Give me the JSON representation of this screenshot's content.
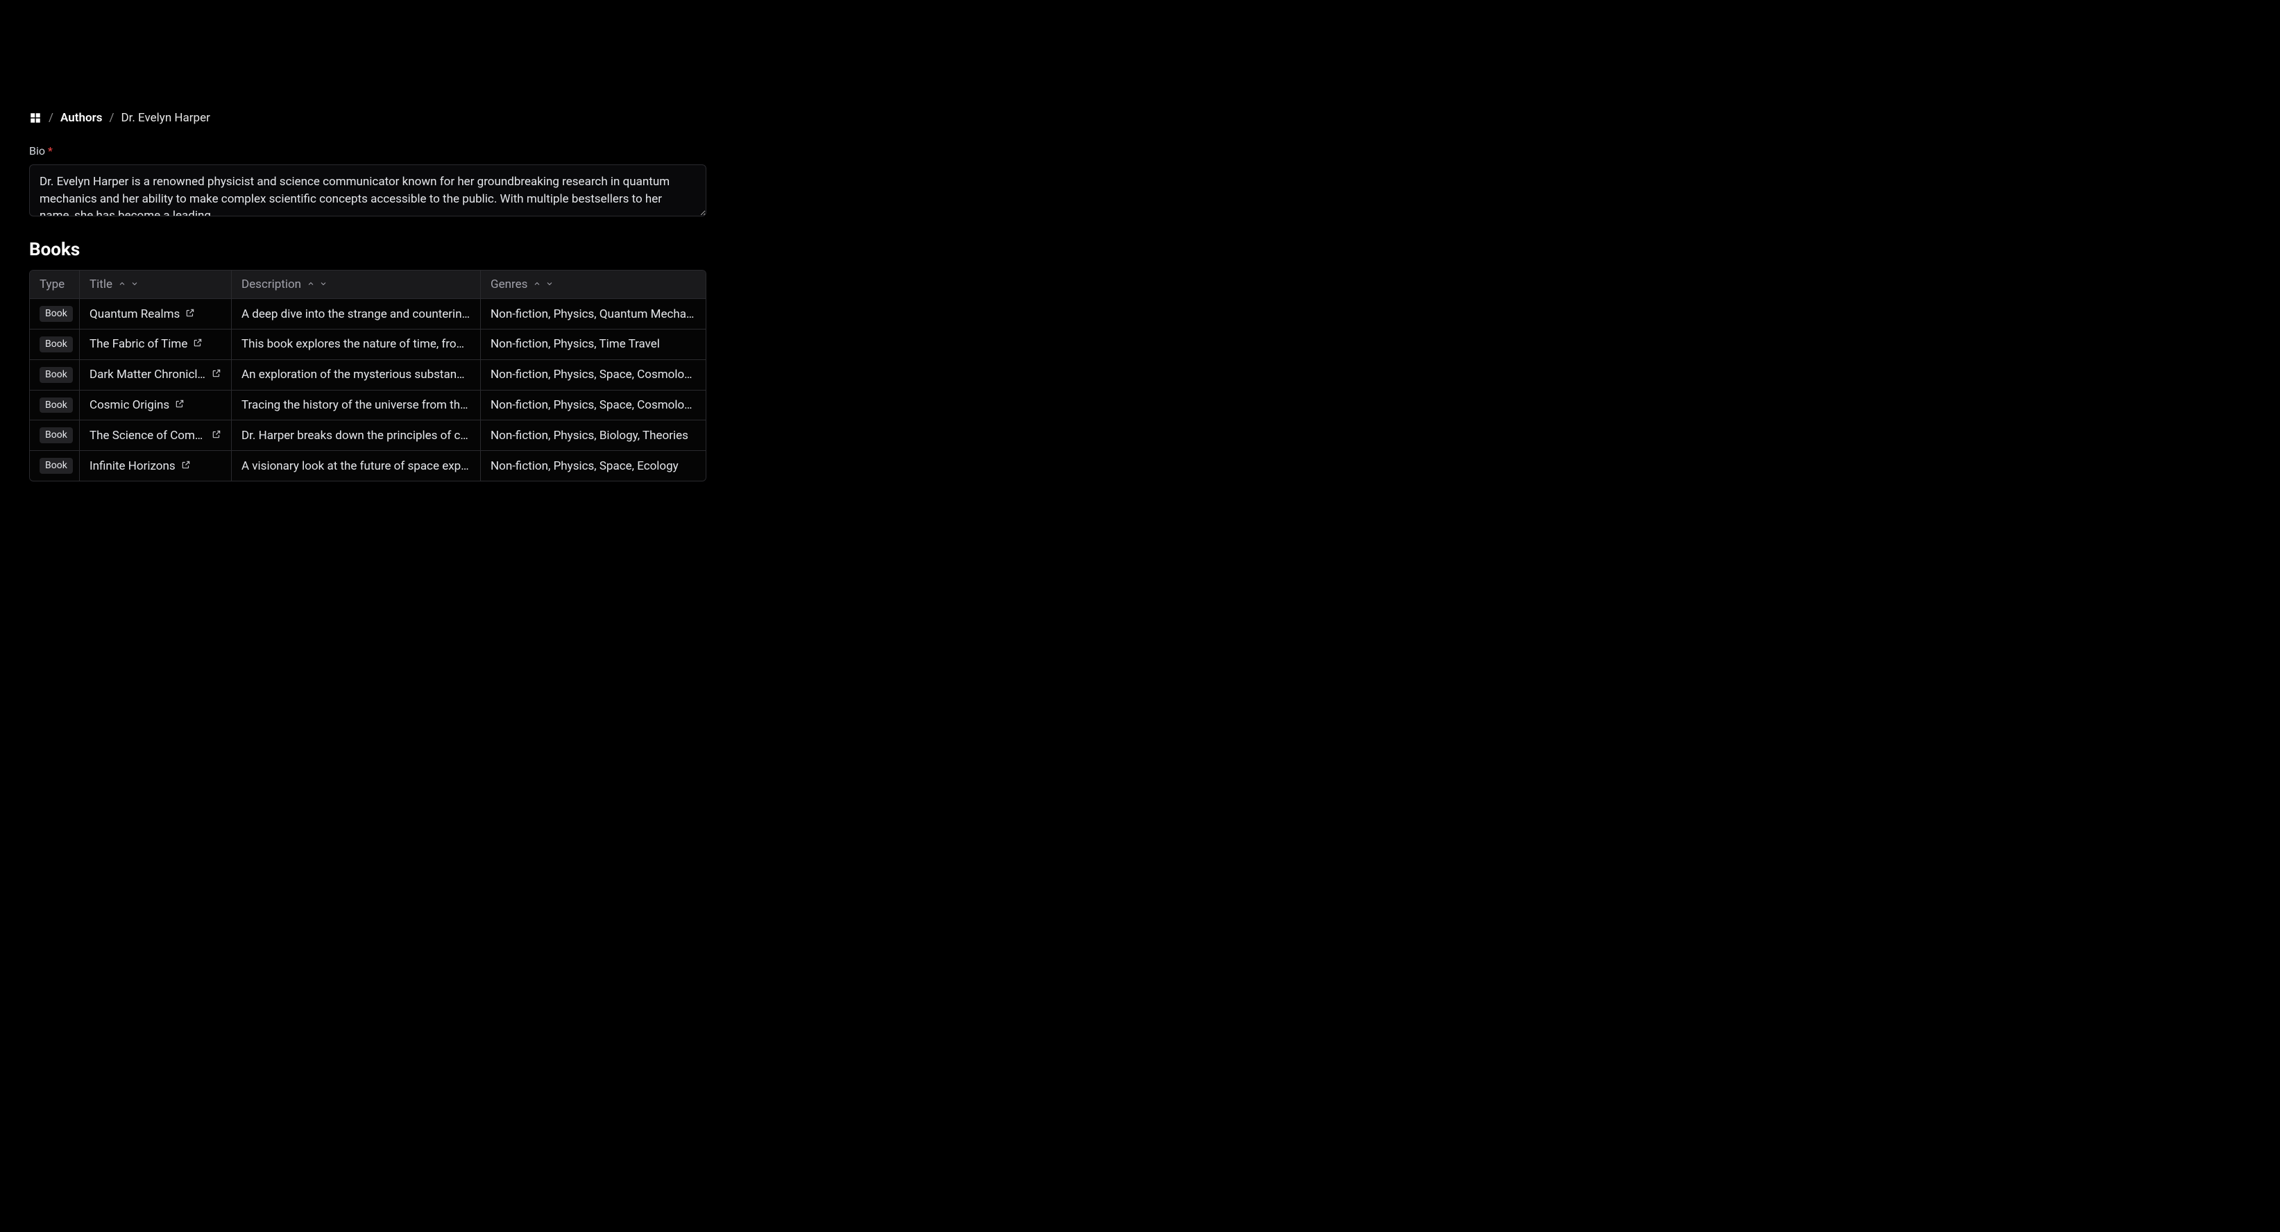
{
  "breadcrumb": {
    "parent": "Authors",
    "current": "Dr. Evelyn Harper"
  },
  "bio": {
    "label": "Bio",
    "required": true,
    "value": "Dr. Evelyn Harper is a renowned physicist and science communicator known for her groundbreaking research in quantum mechanics and her ability to make complex scientific concepts accessible to the public. With multiple bestsellers to her name, she has become a leading…"
  },
  "books": {
    "heading": "Books",
    "columns": {
      "type": "Type",
      "title": "Title",
      "description": "Description",
      "genres": "Genres"
    },
    "type_badge": "Book",
    "rows": [
      {
        "title": "Quantum Realms",
        "description": "A deep dive into the strange and counterintuit…",
        "genres": "Non-fiction, Physics, Quantum Mechanics"
      },
      {
        "title": "The Fabric of Time",
        "description": "This book explores the nature of time, from Ei…",
        "genres": "Non-fiction, Physics, Time Travel"
      },
      {
        "title": "Dark Matter Chronicles",
        "description": "An exploration of the mysterious substance th…",
        "genres": "Non-fiction, Physics, Space, Cosmology"
      },
      {
        "title": "Cosmic Origins",
        "description": "Tracing the history of the universe from the Bi…",
        "genres": "Non-fiction, Physics, Space, Cosmology, Biol…"
      },
      {
        "title": "The Science of Compl…",
        "description": "Dr. Harper breaks down the principles of com…",
        "genres": "Non-fiction, Physics, Biology, Theories"
      },
      {
        "title": "Infinite Horizons",
        "description": "A visionary look at the future of space explora…",
        "genres": "Non-fiction, Physics, Space, Ecology"
      }
    ]
  }
}
